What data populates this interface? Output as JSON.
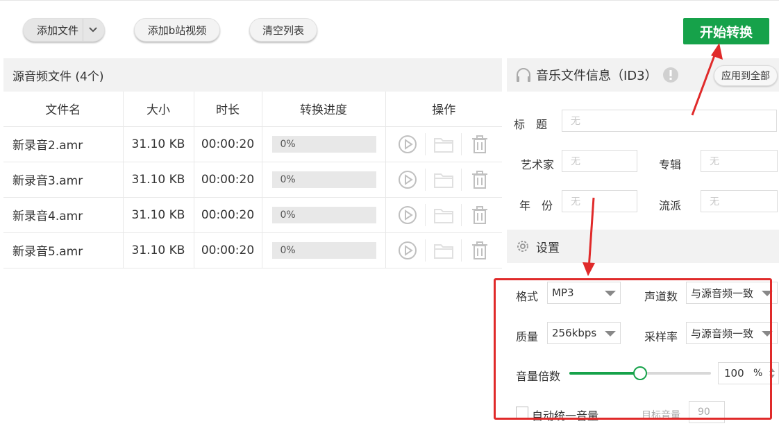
{
  "toolbar": {
    "add_file": "添加文件",
    "add_bilibili": "添加b站视频",
    "clear_list": "清空列表",
    "start": "开始转换"
  },
  "file_list": {
    "title": "源音频文件 (4个)",
    "columns": [
      "文件名",
      "大小",
      "时长",
      "转换进度",
      "操作"
    ],
    "rows": [
      {
        "name": "新录音2.amr",
        "size": "31.10 KB",
        "duration": "00:00:20",
        "progress": "0%"
      },
      {
        "name": "新录音3.amr",
        "size": "31.10 KB",
        "duration": "00:00:20",
        "progress": "0%"
      },
      {
        "name": "新录音4.amr",
        "size": "31.10 KB",
        "duration": "00:00:20",
        "progress": "0%"
      },
      {
        "name": "新录音5.amr",
        "size": "31.10 KB",
        "duration": "00:00:20",
        "progress": "0%"
      }
    ]
  },
  "id3": {
    "title": "音乐文件信息（ID3）",
    "apply_all": "应用到全部",
    "fields": {
      "title_label": "标　题",
      "title_placeholder": "无",
      "artist_label": "艺术家",
      "artist_placeholder": "无",
      "album_label": "专辑",
      "album_placeholder": "无",
      "year_label": "年　份",
      "year_placeholder": "无",
      "genre_label": "流派",
      "genre_placeholder": "无"
    }
  },
  "settings": {
    "title": "设置",
    "format_label": "格式",
    "format_value": "MP3",
    "channels_label": "声道数",
    "channels_value": "与源音频一致",
    "quality_label": "质量",
    "quality_value": "256kbps",
    "samplerate_label": "采样率",
    "samplerate_value": "与源音频一致",
    "volume_label": "音量倍数",
    "volume_value": "100",
    "volume_unit": "%",
    "volume_fraction": 0.5,
    "auto_volume_label": "自动统一音量",
    "target_volume_label": "目标音量",
    "target_volume_value": "90"
  },
  "colors": {
    "accent": "#16a24a",
    "annotation": "#e02a2a"
  }
}
